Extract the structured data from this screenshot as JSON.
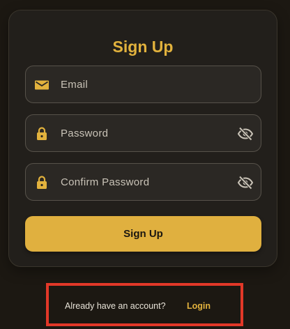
{
  "form": {
    "title": "Sign Up",
    "email": {
      "placeholder": "Email",
      "value": "",
      "icon": "mail-icon"
    },
    "password": {
      "placeholder": "Password",
      "value": "",
      "icon": "lock-icon",
      "toggle_icon": "eye-off-icon"
    },
    "confirm_password": {
      "placeholder": "Confirm Password",
      "value": "",
      "icon": "lock-icon",
      "toggle_icon": "eye-off-icon"
    },
    "submit_label": "Sign Up"
  },
  "footer": {
    "prompt": "Already have an account?",
    "login_label": "Login"
  },
  "colors": {
    "accent": "#e2b23d",
    "background": "#1c1812",
    "card": "#221f1b",
    "highlight_border": "#e23828"
  }
}
